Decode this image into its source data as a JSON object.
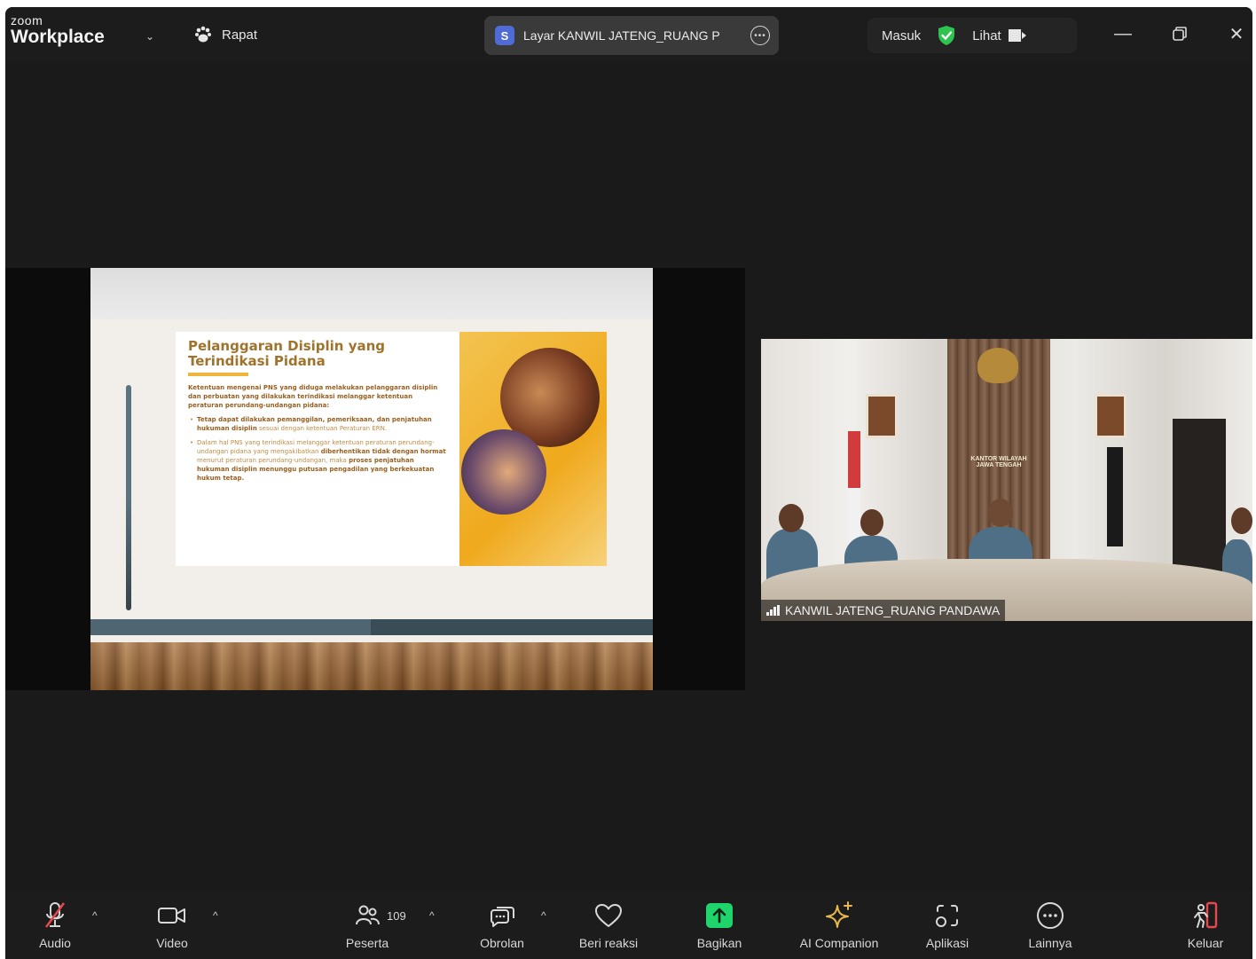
{
  "app": {
    "brand_small": "zoom",
    "brand_large": "Workplace",
    "meeting_menu": "Rapat"
  },
  "share_pill": {
    "badge": "S",
    "label": "Layar KANWIL JATENG_RUANG P"
  },
  "header_right": {
    "masuk": "Masuk",
    "lihat": "Lihat"
  },
  "slide": {
    "title": "Pelanggaran Disiplin yang Terindikasi Pidana",
    "intro": "Ketentuan mengenai PNS yang diduga melakukan pelanggaran disiplin dan perbuatan yang dilakukan terindikasi melanggar ketentuan peraturan perundang-undangan pidana:",
    "bullet1_bold": "Tetap dapat dilakukan pemanggilan, pemeriksaan, dan penjatuhan hukuman disiplin",
    "bullet1_rest": " sesuai dengan ketentuan Peraturan ERN.",
    "bullet2_start": "Dalam hal PNS yang terindikasi melanggar ketentuan peraturan perundang-undangan pidana yang mengakibatkan ",
    "bullet2_bold1": "diberhentikan tidak dengan hormat",
    "bullet2_mid": " menurut peraturan perundang-undangan, maka ",
    "bullet2_bold2": "proses penjatuhan hukuman disiplin menunggu putusan pengadilan yang berkekuatan hukum tetap."
  },
  "video": {
    "participant_name": "KANWIL JATENG_RUANG PANDAWA",
    "sign_line1": "KANTOR WILAYAH",
    "sign_line2": "JAWA TENGAH"
  },
  "toolbar": {
    "audio": "Audio",
    "video": "Video",
    "participants": "Peserta",
    "participants_count": "109",
    "chat": "Obrolan",
    "react": "Beri reaksi",
    "share": "Bagikan",
    "ai": "AI Companion",
    "apps": "Aplikasi",
    "more": "Lainnya",
    "leave": "Keluar"
  },
  "colors": {
    "share_green": "#1fd46a",
    "shield_green": "#2ec24f",
    "leave_red": "#e5484d",
    "ai_gold": "#e6b94a"
  }
}
